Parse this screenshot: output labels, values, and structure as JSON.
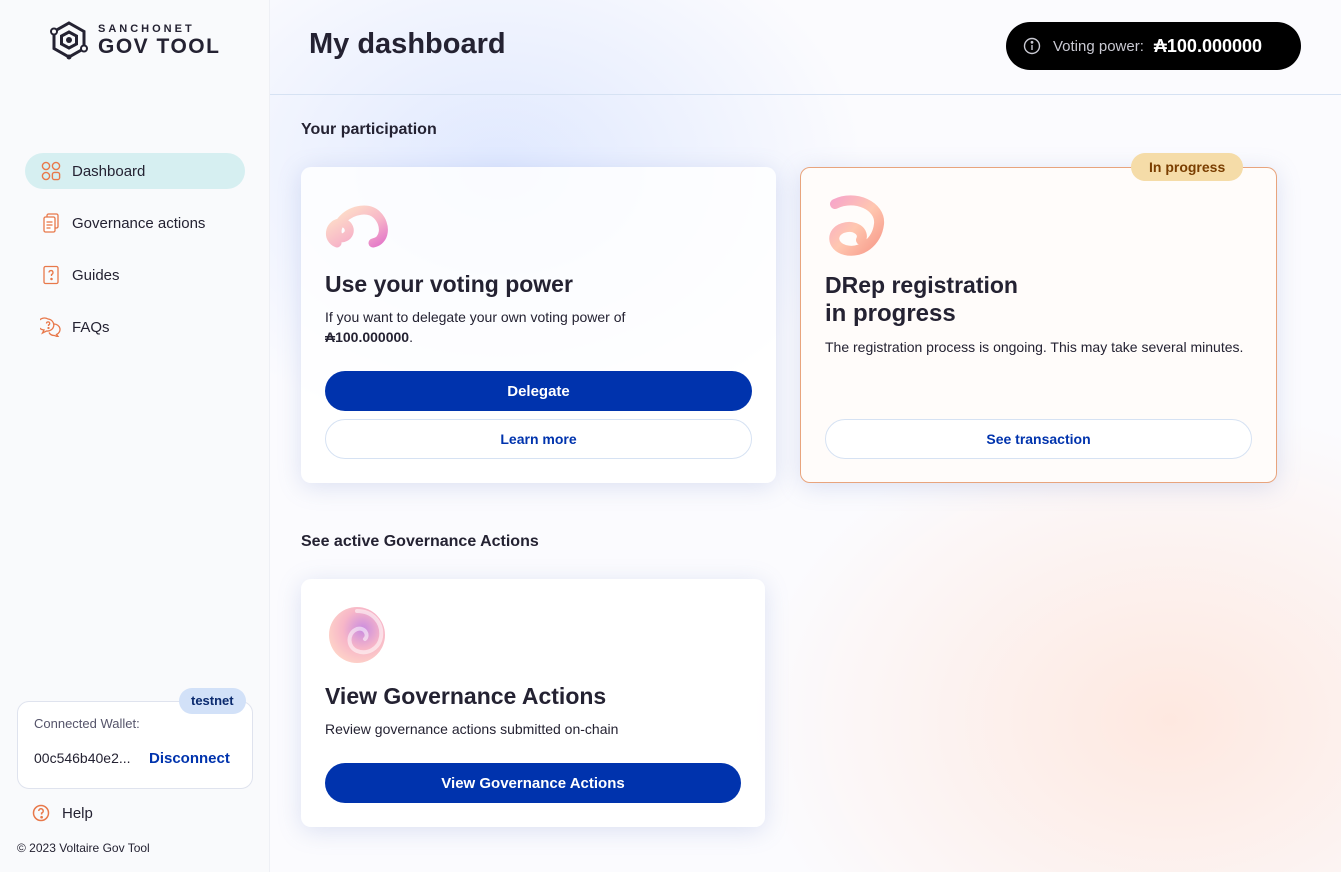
{
  "brand": {
    "top": "SANCHONET",
    "bottom": "GOV TOOL"
  },
  "sidebar": {
    "items": [
      {
        "label": "Dashboard",
        "icon": "dashboard-grid-icon",
        "active": true
      },
      {
        "label": "Governance actions",
        "icon": "documents-icon",
        "active": false
      },
      {
        "label": "Guides",
        "icon": "guide-question-icon",
        "active": false
      },
      {
        "label": "FAQs",
        "icon": "faq-chat-icon",
        "active": false
      }
    ],
    "wallet": {
      "network_badge": "testnet",
      "label": "Connected Wallet:",
      "id": "00c546b40e2...",
      "disconnect": "Disconnect"
    },
    "help": "Help",
    "copyright": "© 2023 Voltaire Gov Tool"
  },
  "header": {
    "title": "My dashboard",
    "voting_power_label": "Voting power:",
    "voting_power_value": "₳100.000000"
  },
  "participation": {
    "section_title": "Your participation",
    "voting_card": {
      "title": "Use your voting power",
      "desc_prefix": "If you want to delegate your own voting power of",
      "desc_amount": "₳100.000000",
      "desc_suffix": ".",
      "primary_button": "Delegate",
      "secondary_button": "Learn more"
    },
    "drep_card": {
      "badge": "In progress",
      "title": "DRep registration",
      "subtitle": "in progress",
      "desc": "The registration process is ongoing. This may take several minutes.",
      "button": "See transaction"
    }
  },
  "governance": {
    "section_title": "See active Governance Actions",
    "card": {
      "title": "View Governance Actions",
      "desc": "Review governance actions submitted on-chain",
      "button": "View Governance Actions"
    }
  },
  "colors": {
    "primary": "#0033ad",
    "active_nav": "#d6eff1",
    "badge_progress": "#f5dca8",
    "drep_border": "#e8a47d"
  }
}
